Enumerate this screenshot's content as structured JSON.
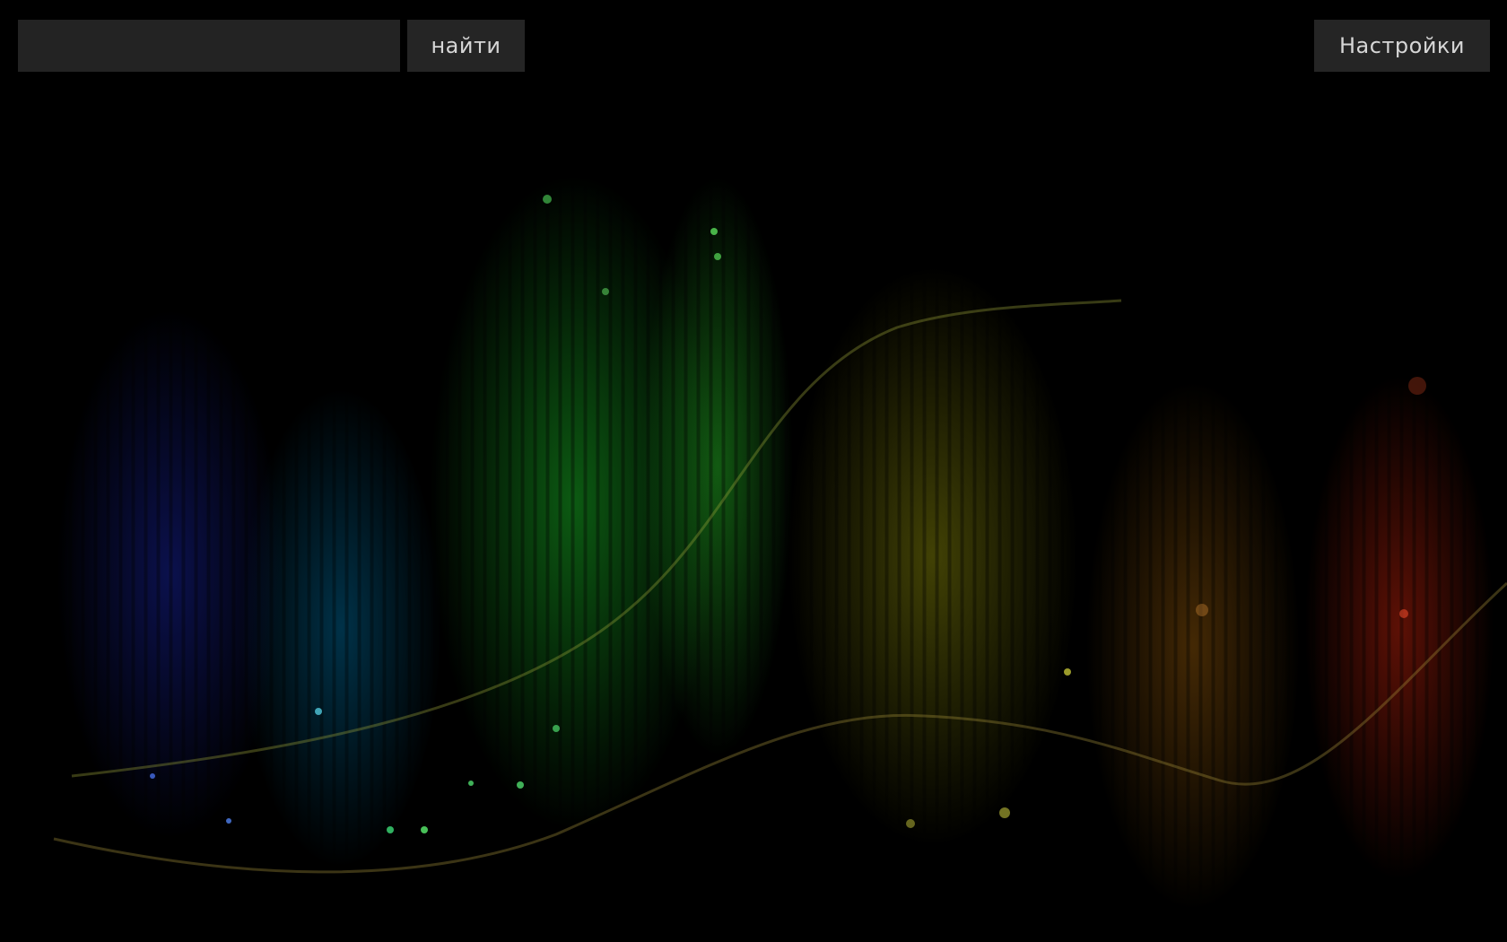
{
  "search": {
    "value": "",
    "placeholder": ""
  },
  "toolbar": {
    "search_label": "найти",
    "settings_label": "Настройки"
  },
  "colors": {
    "button_bg": "#252525",
    "input_bg": "#232323",
    "text": "#d6d6d6",
    "background": "#000000"
  }
}
